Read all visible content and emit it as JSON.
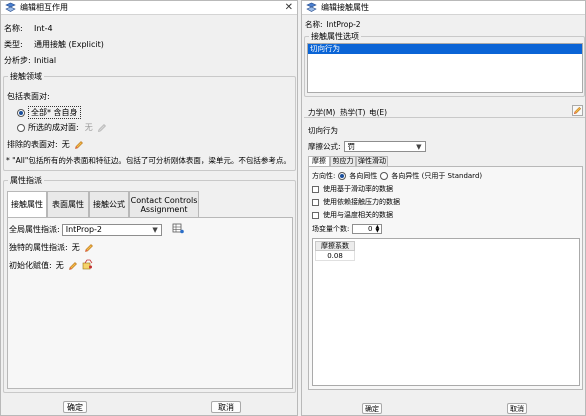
{
  "left": {
    "title": "编辑相互作用",
    "close": "✕",
    "name_label": "名称:",
    "name_value": "Int-4",
    "type_label": "类型:",
    "type_value": "通用接触 (Explicit)",
    "step_label": "分析步:",
    "step_value": "Initial",
    "domain": {
      "legend": "接触领域",
      "include_label": "包括表面对:",
      "all_self_label": "全部* 含自身",
      "selected_label": "所选的成对面:",
      "selected_value": "无",
      "excluded_label": "排除的表面对:",
      "excluded_value": "无",
      "note": "* \"All\"包括所有的外表面和特征边。包括了可分析刚体表面，梁单元。不包括参考点。"
    },
    "attr": {
      "legend": "属性指派",
      "tabs": [
        "接触属性",
        "表面属性",
        "接触公式",
        "Contact Controls Assignment"
      ],
      "global_label": "全局属性指派:",
      "global_value": "IntProp-2",
      "individual_label": "独特的属性指派:",
      "individual_value": "无",
      "init_label": "初始化赋值:",
      "init_value": "无"
    },
    "ok": "确定",
    "cancel": "取消"
  },
  "right": {
    "title": "编辑接触属性",
    "name_label": "名称:",
    "name_value": "IntProp-2",
    "options_legend": "接触属性选项",
    "options": [
      "切向行为"
    ],
    "menu": [
      "力学(M)",
      "热学(T)",
      "电(E)"
    ],
    "tangent_title": "切向行为",
    "friction_label": "摩擦公式:",
    "friction_value": "罚",
    "subtabs": [
      "摩擦",
      "剪应力",
      "弹性滑动"
    ],
    "direction_label": "方向性:",
    "isotropic_label": "各向同性",
    "anisotropic_label": "各向异性 (只用于 Standard)",
    "checks": [
      "使用基于滑动率的数据",
      "使用依赖接触压力的数据",
      "使用与温度相关的数据"
    ],
    "field_vars_label": "场变量个数:",
    "field_vars_value": "0",
    "table_header": "摩擦系数",
    "table_values": [
      "0.08"
    ],
    "ok": "确定",
    "cancel": "取消"
  },
  "colors": {
    "selection": "#0a64d6",
    "titlebar": "#ffffff",
    "dialog_bg": "#f0f0f0"
  }
}
